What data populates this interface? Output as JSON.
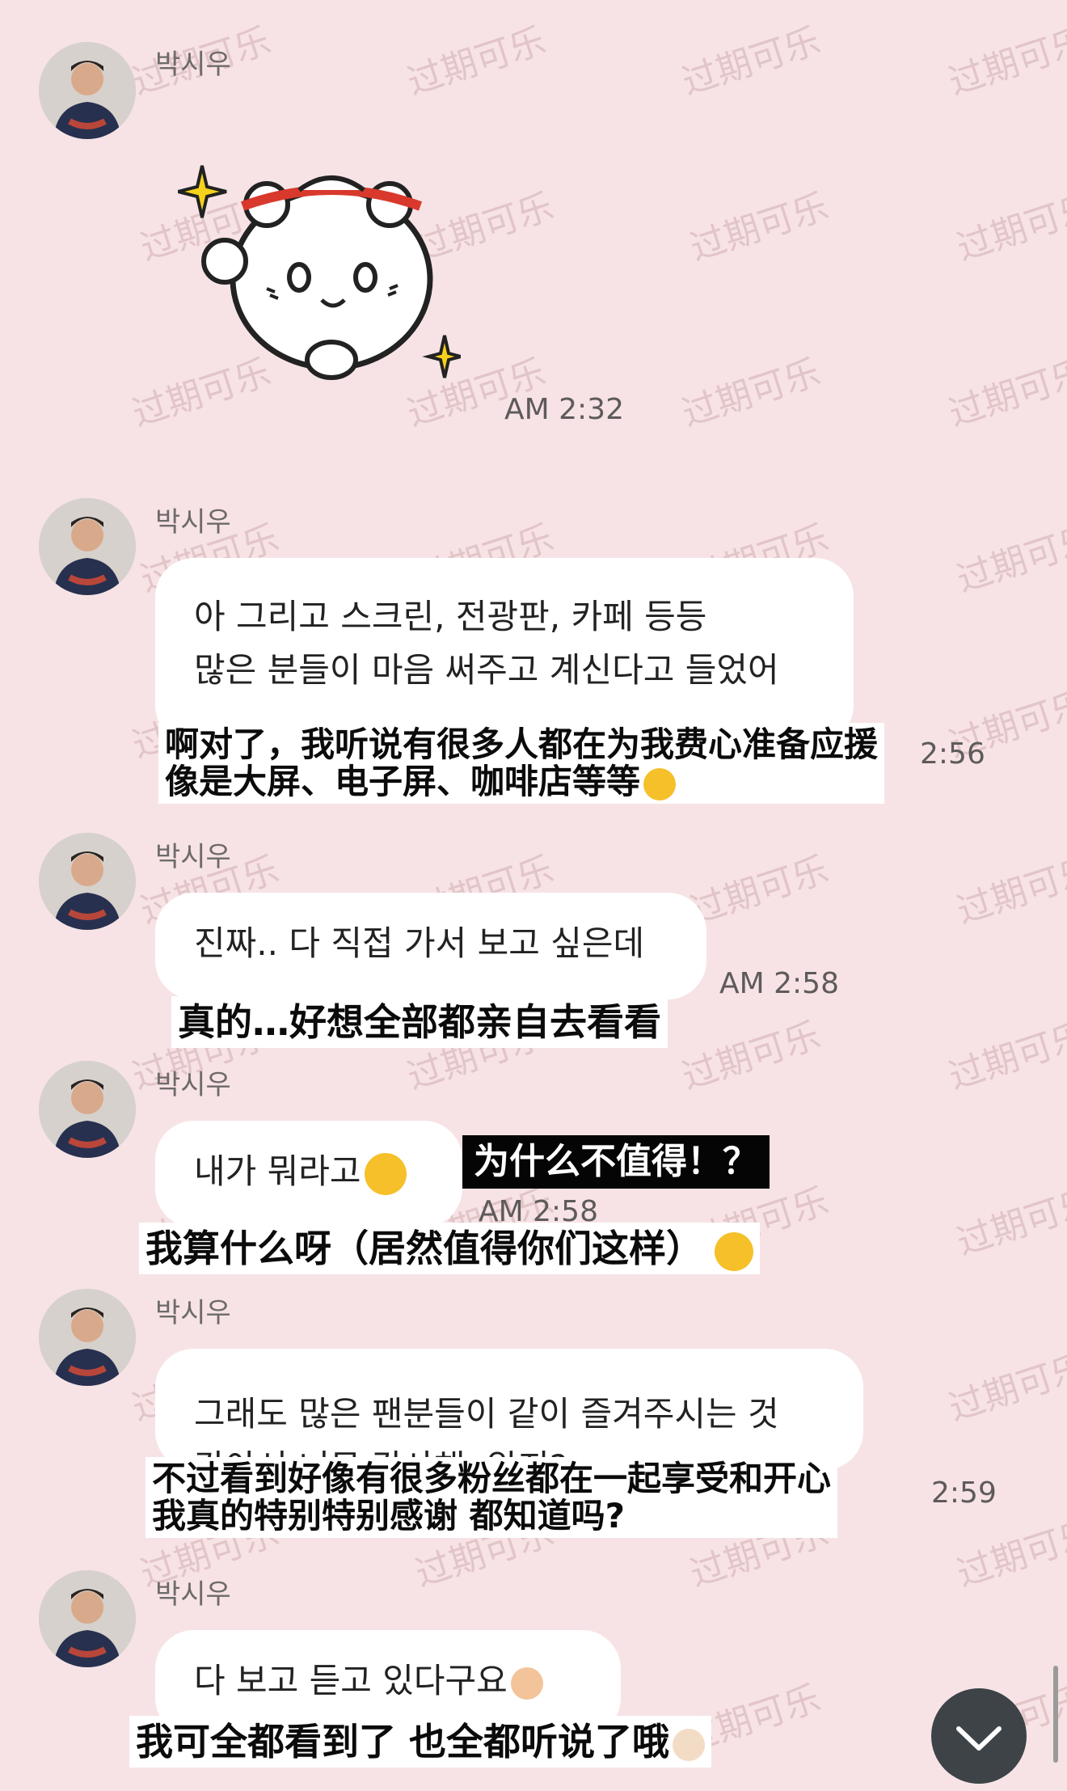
{
  "watermark_text": "过期可乐",
  "colors": {
    "background": "#f7e3e5",
    "bubble": "#ffffff",
    "scroll_button": "#3d4347"
  },
  "messages": [
    {
      "sender": "박시우",
      "type": "sticker",
      "sticker_icon": "bear-sticker-icon",
      "time": "AM 2:32"
    },
    {
      "sender": "박시우",
      "lines": [
        "아 그리고 스크린, 전광판, 카페 등등",
        "많은 분들이 마음 써주고 계신다고 들었어"
      ],
      "time": "2:56",
      "translation": [
        "啊对了，我听说有很多人都在为我费心准备应援",
        "像是大屏、电子屏、咖啡店等等"
      ]
    },
    {
      "sender": "박시우",
      "lines": [
        "진짜.. 다 직접 가서 보고 싶은데"
      ],
      "time": "AM 2:58",
      "translation": [
        "真的…好想全部都亲自去看看"
      ]
    },
    {
      "sender": "박시우",
      "lines": [
        "내가 뭐라고"
      ],
      "time": "AM 2:58",
      "translation": [
        "我算什么呀（居然值得你们这样）"
      ],
      "caption": "为什么不值得！？"
    },
    {
      "sender": "박시우",
      "lines": [
        "그래도 많은 팬분들이 같이 즐겨주시는 것",
        "같아서 너무 감사해, 알지?"
      ],
      "time": "2:59",
      "translation": [
        "不过看到好像有很多粉丝都在一起享受和开心",
        "我真的特别特别感谢 都知道吗?"
      ]
    },
    {
      "sender": "박시우",
      "lines": [
        "다 보고 듣고 있다구요"
      ],
      "translation": [
        "我可全都看到了 也全都听说了哦"
      ]
    }
  ]
}
